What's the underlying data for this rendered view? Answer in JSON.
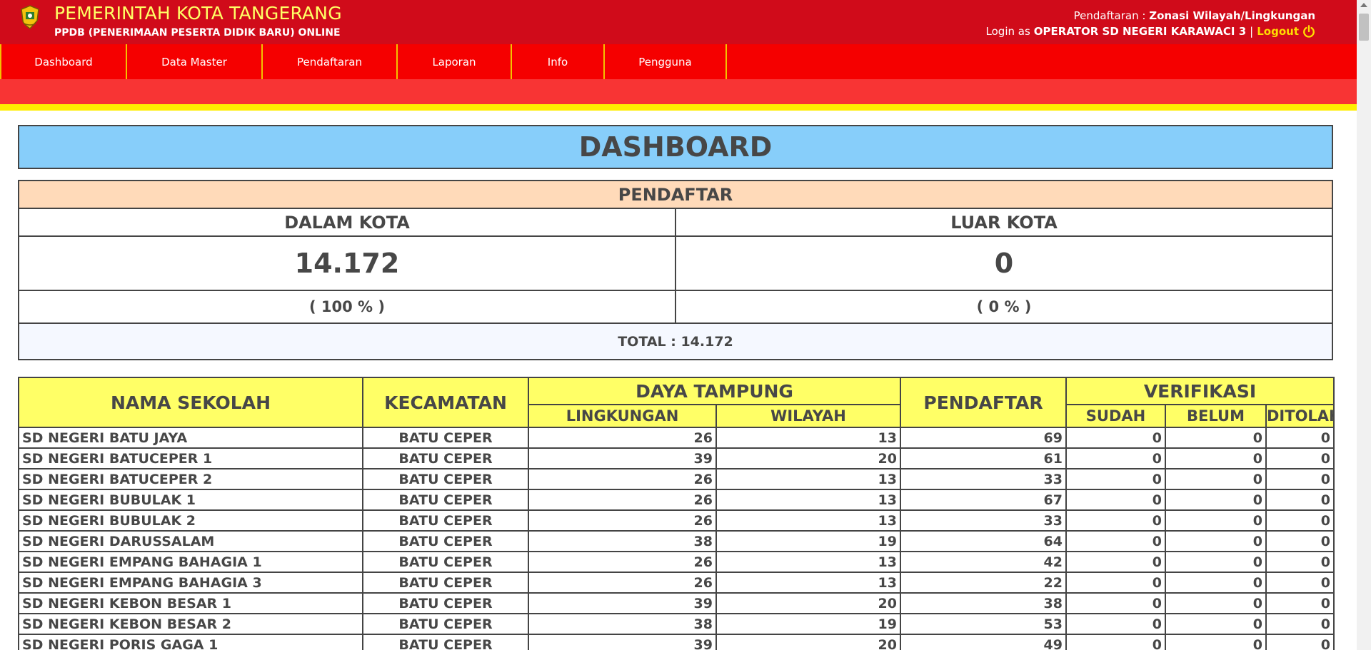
{
  "header": {
    "title": "PEMERINTAH KOTA TANGERANG",
    "subtitle": "PPDB (PENERIMAAN PESERTA DIDIK BARU) ONLINE",
    "registration_label": "Pendaftaran :",
    "registration_value": "Zonasi Wilayah/Lingkungan",
    "login_label": "Login as",
    "login_user": "OPERATOR SD NEGERI KARAWACI 3",
    "separator": "|",
    "logout_label": "Logout"
  },
  "nav": [
    "Dashboard",
    "Data Master",
    "Pendaftaran",
    "Laporan",
    "Info",
    "Pengguna"
  ],
  "dashboard": {
    "title": "DASHBOARD",
    "pendaftar_title": "PENDAFTAR",
    "dalam_kota_label": "DALAM KOTA",
    "luar_kota_label": "LUAR KOTA",
    "dalam_kota_value": "14.172",
    "luar_kota_value": "0",
    "dalam_kota_pct": "( 100 % )",
    "luar_kota_pct": "( 0 % )",
    "total": "TOTAL : 14.172"
  },
  "table": {
    "headers": {
      "nama_sekolah": "NAMA SEKOLAH",
      "kecamatan": "KECAMATAN",
      "daya_tampung": "DAYA TAMPUNG",
      "lingkungan": "LINGKUNGAN",
      "wilayah": "WILAYAH",
      "pendaftar": "PENDAFTAR",
      "verifikasi": "VERIFIKASI",
      "sudah": "SUDAH",
      "belum": "BELUM",
      "ditolak": "DITOLAK"
    },
    "rows": [
      [
        "SD NEGERI BATU JAYA",
        "BATU CEPER",
        "26",
        "13",
        "69",
        "0",
        "0",
        "0"
      ],
      [
        "SD NEGERI BATUCEPER 1",
        "BATU CEPER",
        "39",
        "20",
        "61",
        "0",
        "0",
        "0"
      ],
      [
        "SD NEGERI BATUCEPER 2",
        "BATU CEPER",
        "26",
        "13",
        "33",
        "0",
        "0",
        "0"
      ],
      [
        "SD NEGERI BUBULAK 1",
        "BATU CEPER",
        "26",
        "13",
        "67",
        "0",
        "0",
        "0"
      ],
      [
        "SD NEGERI BUBULAK 2",
        "BATU CEPER",
        "26",
        "13",
        "33",
        "0",
        "0",
        "0"
      ],
      [
        "SD NEGERI DARUSSALAM",
        "BATU CEPER",
        "38",
        "19",
        "64",
        "0",
        "0",
        "0"
      ],
      [
        "SD NEGERI EMPANG BAHAGIA 1",
        "BATU CEPER",
        "26",
        "13",
        "42",
        "0",
        "0",
        "0"
      ],
      [
        "SD NEGERI EMPANG BAHAGIA 3",
        "BATU CEPER",
        "26",
        "13",
        "22",
        "0",
        "0",
        "0"
      ],
      [
        "SD NEGERI KEBON BESAR 1",
        "BATU CEPER",
        "39",
        "20",
        "38",
        "0",
        "0",
        "0"
      ],
      [
        "SD NEGERI KEBON BESAR 2",
        "BATU CEPER",
        "38",
        "19",
        "53",
        "0",
        "0",
        "0"
      ],
      [
        "SD NEGERI PORIS GAGA 1",
        "BATU CEPER",
        "39",
        "20",
        "49",
        "0",
        "0",
        "0"
      ]
    ]
  },
  "colors": {
    "header_bg": "#d00b1a",
    "nav_bg": "#f50000",
    "accent_yellow": "#ffff66",
    "dashboard_title_bg": "#87cefa",
    "pendaftar_bg": "#ffdab9"
  },
  "icons": {
    "logo": "tangerang-crest-icon",
    "logout": "power-icon"
  }
}
